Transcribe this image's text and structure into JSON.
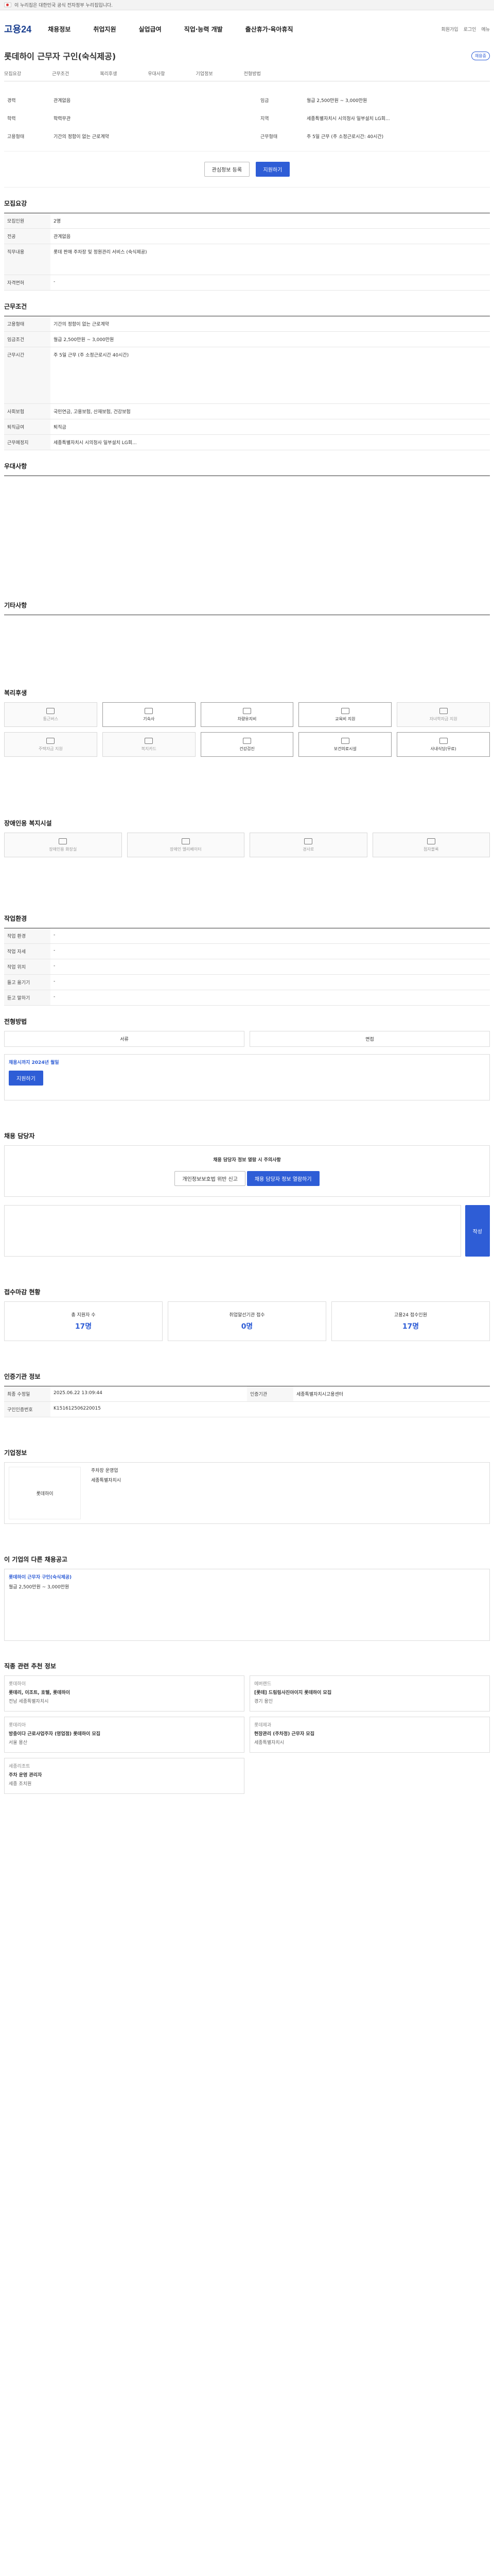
{
  "topbar": {
    "text": "이 누리집은 대한민국 공식 전자정부 누리집입니다."
  },
  "header": {
    "logo": "고용24",
    "gnb": [
      "채용정보",
      "취업지원",
      "실업급여",
      "직업·능력 개발",
      "출산휴가·육아휴직"
    ],
    "util": [
      "회원가입",
      "로그인",
      "메뉴"
    ]
  },
  "job": {
    "company": "롯데하이 근무자 구인(숙식제공)",
    "badge": "채용중",
    "tabs": [
      "모집요강",
      "근무조건",
      "복리후생",
      "우대사항",
      "기업정보",
      "전형방법",
      "기업정보"
    ],
    "summary": [
      {
        "k": "경력",
        "v": "관계없음"
      },
      {
        "k": "학력",
        "v": "학력무관"
      },
      {
        "k": "임금",
        "v": "월급 2,500만원 ~ 3,000만원"
      },
      {
        "k": "지역",
        "v": "세종특별자치시 시의청사 일부설치 LG회..."
      },
      {
        "k": "고용형태",
        "v": "기간의 정함이 없는 근로계약"
      },
      {
        "k": "근무형태",
        "v": "주 5일 근무 (주 소정근로시간: 40시간)"
      }
    ],
    "apply_label": "지원하기",
    "scrap_label": "관심정보 등록"
  },
  "sections": {
    "s1": "모집요강",
    "s2": "근무조건",
    "s3": "우대사항",
    "s4": "기타사항",
    "s5": "복리후생",
    "s6": "장애인용 복지시설",
    "s7": "작업환경",
    "s8": "전형방법",
    "s9": "채용 담당자",
    "s10": "접수마감 현황",
    "s11": "인증기관 정보",
    "s12": "기업정보",
    "s13": "이 기업의 다른 채용공고",
    "s14": "직종 관련 추천 정보"
  },
  "recruit": [
    {
      "k": "모집인원",
      "v": "2명"
    },
    {
      "k": "전공",
      "v": "관계없음"
    },
    {
      "k": "직무내용",
      "v": "롯데 판매 주차장 및 정원관리 서비스 (숙식제공)"
    },
    {
      "k": "자격면허",
      "v": "-"
    }
  ],
  "work": [
    {
      "k": "고용형태",
      "v": "기간의 정함이 없는 근로계약"
    },
    {
      "k": "임금조건",
      "v": "월급 2,500만원 ~ 3,000만원"
    },
    {
      "k": "근무시간",
      "v": "주 5일 근무 (주 소정근로시간 40시간)"
    },
    {
      "k": "사회보험",
      "v": "국민연금, 고용보험, 산재보험, 건강보험"
    },
    {
      "k": "퇴직급여",
      "v": "퇴직금"
    },
    {
      "k": "근무예정지",
      "v": "세종특별자치시 시의청사 일부설치 LG회..."
    }
  ],
  "benefit_icons": [
    "통근버스",
    "기숙사",
    "차량유지비",
    "교육비 지원",
    "자녀학자금 지원",
    "주택자금 지원",
    "복지카드",
    "건강검진",
    "보건의료시설",
    "사내식당(무료)"
  ],
  "benefit_on": [
    1,
    2,
    3,
    7,
    8,
    9
  ],
  "facility_icons": [
    "장애인용 화장실",
    "장애인 엘리베이터",
    "경사로",
    "점자블록"
  ],
  "env": [
    {
      "k": "작업 환경",
      "v": "-"
    },
    {
      "k": "작업 자세",
      "v": "-"
    },
    {
      "k": "작업 위치",
      "v": "-"
    },
    {
      "k": "들고 옮기기",
      "v": "-"
    },
    {
      "k": "듣고 말하기",
      "v": "-"
    }
  ],
  "process": {
    "steps": [
      "서류",
      "면접"
    ],
    "deadline": "채용시까지 2024년 월일"
  },
  "contact": {
    "title": "채용 담당자 정보 열람 시 주의사항",
    "btn1": "개인정보보호법 위반 신고",
    "btn2": "채용 담당자 정보 열람하기",
    "submit": "작성"
  },
  "stats": [
    {
      "k": "총 지원자 수",
      "v": "17명"
    },
    {
      "k": "취업알선기관 접수",
      "v": "0명"
    },
    {
      "k": "고용24 접수인원",
      "v": "17명"
    }
  ],
  "cert": [
    {
      "k": "최종 수정일",
      "v": "2025.06.22 13:09:44"
    },
    {
      "k": "인증기관",
      "v": "세종특별자치시고용센터"
    },
    {
      "k": "구인인증번호",
      "v": "K151612506220015"
    }
  ],
  "company": {
    "name": "롯데하이",
    "ceo": "대표자",
    "industry": "주차장 운영업",
    "addr": "세종특별자치시"
  },
  "other_job": {
    "title": "롯데하이 근무자 구인(숙식제공)",
    "wage": "월급 2,500만원 ~ 3,000만원"
  },
  "recommend": [
    {
      "org": "롯데하이",
      "title": "롯데리, 이조트, 호텔, 롯데하이",
      "loc": "전남 세종특별자치시"
    },
    {
      "org": "에버랜드",
      "title": "[롯데] 드림링사진아이지 롯데하이 모집",
      "loc": "경기 용인"
    },
    {
      "org": "롯데리아",
      "title": "방충이다 근로사업주자 (영업점) 롯데하이 모집",
      "loc": "서울 용산"
    },
    {
      "org": "롯데제과",
      "title": "현장관리 (주차정) 근무자 모집",
      "loc": "세종특별자치시"
    },
    {
      "org": "세종리조트",
      "title": "주차 운영 관리자",
      "loc": "세종 조치원"
    }
  ]
}
